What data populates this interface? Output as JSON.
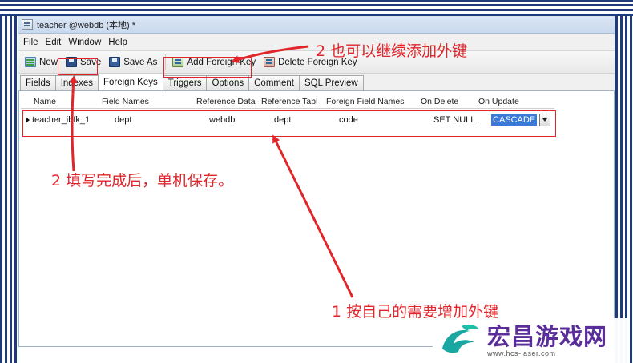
{
  "window": {
    "title": "teacher @webdb (本地) *"
  },
  "menu": [
    "File",
    "Edit",
    "Window",
    "Help"
  ],
  "toolbar": {
    "new_label": "New",
    "save_label": "Save",
    "save_as_label": "Save As",
    "add_fk_label": "Add Foreign Key",
    "delete_fk_label": "Delete Foreign Key"
  },
  "tabs": [
    "Fields",
    "Indexes",
    "Foreign Keys",
    "Triggers",
    "Options",
    "Comment",
    "SQL Preview"
  ],
  "active_tab": "Foreign Keys",
  "grid": {
    "columns": [
      "Name",
      "Field Names",
      "Reference Data",
      "Reference Tabl",
      "Foreign Field Names",
      "On Delete",
      "On Update"
    ],
    "rows": [
      {
        "name": "teacher_ibfk_1",
        "field_names": "dept",
        "ref_database": "webdb",
        "ref_table": "dept",
        "foreign_field": "code",
        "on_delete": "SET NULL",
        "on_update": "CASCADE"
      }
    ]
  },
  "annotations": {
    "step_add": "2 也可以继续添加外键",
    "step_save": "2 填写完成后，单机保存。",
    "step_need": "1 按自己的需要增加外键"
  },
  "watermark": {
    "brand": "宏昌游戏网",
    "url": "www.hcs-laser.com"
  },
  "colors": {
    "annotation": "#e0262b",
    "selection": "#3a79d8",
    "brand": "#5b2d9a"
  }
}
